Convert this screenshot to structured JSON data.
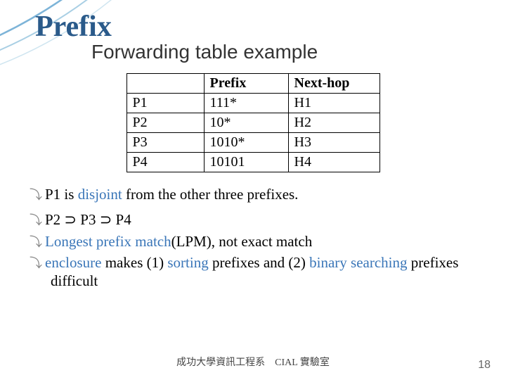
{
  "title": "Prefix",
  "subtitle": "Forwarding table example",
  "table": {
    "header": {
      "c0": "",
      "c1": "Prefix",
      "c2": "Next-hop"
    },
    "rows": [
      {
        "c0": "P1",
        "c1": "111*",
        "c2": "H1"
      },
      {
        "c0": "P2",
        "c1": "10*",
        "c2": "H2"
      },
      {
        "c0": "P3",
        "c1": "1010*",
        "c2": "H3"
      },
      {
        "c0": "P4",
        "c1": "10101",
        "c2": "H4"
      }
    ]
  },
  "b1_a": "P1 is ",
  "b1_b": "disjoint",
  "b1_c": " from the other three prefixes.",
  "b2": "P2 ⊃ P3 ⊃ P4",
  "b3_a": "Longest prefix match",
  "b3_b": "(LPM), not exact match",
  "b4_a": "enclosure",
  "b4_b": " makes (1) ",
  "b4_c": "sorting",
  "b4_d": " prefixes and (2) ",
  "b4_e": "binary searching",
  "b4_f": " prefixes difficult",
  "footer": "成功大學資訊工程系　CIAL 實驗室",
  "pagenum": "18"
}
